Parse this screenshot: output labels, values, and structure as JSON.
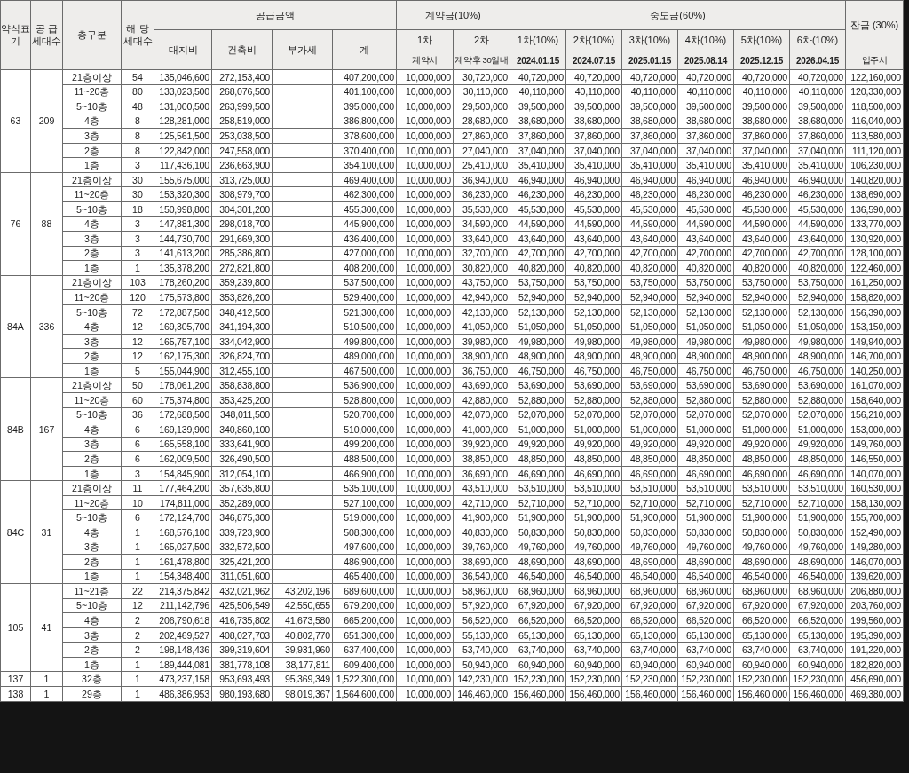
{
  "columns": {
    "type": "약식표기",
    "supply_units": "공 급 세대수",
    "floor": "층구분",
    "units": "해 당 세대수",
    "supply_price": {
      "label": "공급금액",
      "parts": [
        "대지비",
        "건축비",
        "부가세",
        "계"
      ]
    },
    "deposit": {
      "label": "계약금(10%)",
      "parts": [
        {
          "label": "1차",
          "due": "계약시"
        },
        {
          "label": "2차",
          "due": "계약후 30일내"
        }
      ]
    },
    "middle": {
      "label": "중도금(60%)",
      "parts": [
        {
          "label": "1차(10%)",
          "due": "2024.01.15"
        },
        {
          "label": "2차(10%)",
          "due": "2024.07.15"
        },
        {
          "label": "3차(10%)",
          "due": "2025.01.15"
        },
        {
          "label": "4차(10%)",
          "due": "2025.08.14"
        },
        {
          "label": "5차(10%)",
          "due": "2025.12.15"
        },
        {
          "label": "6차(10%)",
          "due": "2026.04.15"
        }
      ]
    },
    "balance": {
      "label": "잔금 (30%)",
      "due": "입주시"
    }
  },
  "groups": [
    {
      "type": "63",
      "supply_units": "209",
      "rows": [
        {
          "floor": "21층이상",
          "units": "54",
          "land": "135,046,600",
          "building": "272,153,400",
          "total": "407,200,000",
          "deposit_1": "10,000,000",
          "deposit_2": "30,720,000",
          "middle": [
            "40,720,000",
            "40,720,000",
            "40,720,000",
            "40,720,000",
            "40,720,000",
            "40,720,000"
          ],
          "balance": "122,160,000"
        },
        {
          "floor": "11~20층",
          "units": "80",
          "land": "133,023,500",
          "building": "268,076,500",
          "total": "401,100,000",
          "deposit_1": "10,000,000",
          "deposit_2": "30,110,000",
          "middle": [
            "40,110,000",
            "40,110,000",
            "40,110,000",
            "40,110,000",
            "40,110,000",
            "40,110,000"
          ],
          "balance": "120,330,000"
        },
        {
          "floor": "5~10층",
          "units": "48",
          "land": "131,000,500",
          "building": "263,999,500",
          "total": "395,000,000",
          "deposit_1": "10,000,000",
          "deposit_2": "29,500,000",
          "middle": [
            "39,500,000",
            "39,500,000",
            "39,500,000",
            "39,500,000",
            "39,500,000",
            "39,500,000"
          ],
          "balance": "118,500,000"
        },
        {
          "floor": "4층",
          "units": "8",
          "land": "128,281,000",
          "building": "258,519,000",
          "total": "386,800,000",
          "deposit_1": "10,000,000",
          "deposit_2": "28,680,000",
          "middle": [
            "38,680,000",
            "38,680,000",
            "38,680,000",
            "38,680,000",
            "38,680,000",
            "38,680,000"
          ],
          "balance": "116,040,000"
        },
        {
          "floor": "3층",
          "units": "8",
          "land": "125,561,500",
          "building": "253,038,500",
          "total": "378,600,000",
          "deposit_1": "10,000,000",
          "deposit_2": "27,860,000",
          "middle": [
            "37,860,000",
            "37,860,000",
            "37,860,000",
            "37,860,000",
            "37,860,000",
            "37,860,000"
          ],
          "balance": "113,580,000"
        },
        {
          "floor": "2층",
          "units": "8",
          "land": "122,842,000",
          "building": "247,558,000",
          "total": "370,400,000",
          "deposit_1": "10,000,000",
          "deposit_2": "27,040,000",
          "middle": [
            "37,040,000",
            "37,040,000",
            "37,040,000",
            "37,040,000",
            "37,040,000",
            "37,040,000"
          ],
          "balance": "111,120,000"
        },
        {
          "floor": "1층",
          "units": "3",
          "land": "117,436,100",
          "building": "236,663,900",
          "total": "354,100,000",
          "deposit_1": "10,000,000",
          "deposit_2": "25,410,000",
          "middle": [
            "35,410,000",
            "35,410,000",
            "35,410,000",
            "35,410,000",
            "35,410,000",
            "35,410,000"
          ],
          "balance": "106,230,000"
        }
      ]
    },
    {
      "type": "76",
      "supply_units": "88",
      "rows": [
        {
          "floor": "21층이상",
          "units": "30",
          "land": "155,675,000",
          "building": "313,725,000",
          "total": "469,400,000",
          "deposit_1": "10,000,000",
          "deposit_2": "36,940,000",
          "middle": [
            "46,940,000",
            "46,940,000",
            "46,940,000",
            "46,940,000",
            "46,940,000",
            "46,940,000"
          ],
          "balance": "140,820,000"
        },
        {
          "floor": "11~20층",
          "units": "30",
          "land": "153,320,300",
          "building": "308,979,700",
          "total": "462,300,000",
          "deposit_1": "10,000,000",
          "deposit_2": "36,230,000",
          "middle": [
            "46,230,000",
            "46,230,000",
            "46,230,000",
            "46,230,000",
            "46,230,000",
            "46,230,000"
          ],
          "balance": "138,690,000"
        },
        {
          "floor": "5~10층",
          "units": "18",
          "land": "150,998,800",
          "building": "304,301,200",
          "total": "455,300,000",
          "deposit_1": "10,000,000",
          "deposit_2": "35,530,000",
          "middle": [
            "45,530,000",
            "45,530,000",
            "45,530,000",
            "45,530,000",
            "45,530,000",
            "45,530,000"
          ],
          "balance": "136,590,000"
        },
        {
          "floor": "4층",
          "units": "3",
          "land": "147,881,300",
          "building": "298,018,700",
          "total": "445,900,000",
          "deposit_1": "10,000,000",
          "deposit_2": "34,590,000",
          "middle": [
            "44,590,000",
            "44,590,000",
            "44,590,000",
            "44,590,000",
            "44,590,000",
            "44,590,000"
          ],
          "balance": "133,770,000"
        },
        {
          "floor": "3층",
          "units": "3",
          "land": "144,730,700",
          "building": "291,669,300",
          "total": "436,400,000",
          "deposit_1": "10,000,000",
          "deposit_2": "33,640,000",
          "middle": [
            "43,640,000",
            "43,640,000",
            "43,640,000",
            "43,640,000",
            "43,640,000",
            "43,640,000"
          ],
          "balance": "130,920,000"
        },
        {
          "floor": "2층",
          "units": "3",
          "land": "141,613,200",
          "building": "285,386,800",
          "total": "427,000,000",
          "deposit_1": "10,000,000",
          "deposit_2": "32,700,000",
          "middle": [
            "42,700,000",
            "42,700,000",
            "42,700,000",
            "42,700,000",
            "42,700,000",
            "42,700,000"
          ],
          "balance": "128,100,000"
        },
        {
          "floor": "1층",
          "units": "1",
          "land": "135,378,200",
          "building": "272,821,800",
          "total": "408,200,000",
          "deposit_1": "10,000,000",
          "deposit_2": "30,820,000",
          "middle": [
            "40,820,000",
            "40,820,000",
            "40,820,000",
            "40,820,000",
            "40,820,000",
            "40,820,000"
          ],
          "balance": "122,460,000"
        }
      ]
    },
    {
      "type": "84A",
      "supply_units": "336",
      "rows": [
        {
          "floor": "21층이상",
          "units": "103",
          "land": "178,260,200",
          "building": "359,239,800",
          "total": "537,500,000",
          "deposit_1": "10,000,000",
          "deposit_2": "43,750,000",
          "middle": [
            "53,750,000",
            "53,750,000",
            "53,750,000",
            "53,750,000",
            "53,750,000",
            "53,750,000"
          ],
          "balance": "161,250,000"
        },
        {
          "floor": "11~20층",
          "units": "120",
          "land": "175,573,800",
          "building": "353,826,200",
          "total": "529,400,000",
          "deposit_1": "10,000,000",
          "deposit_2": "42,940,000",
          "middle": [
            "52,940,000",
            "52,940,000",
            "52,940,000",
            "52,940,000",
            "52,940,000",
            "52,940,000"
          ],
          "balance": "158,820,000"
        },
        {
          "floor": "5~10층",
          "units": "72",
          "land": "172,887,500",
          "building": "348,412,500",
          "total": "521,300,000",
          "deposit_1": "10,000,000",
          "deposit_2": "42,130,000",
          "middle": [
            "52,130,000",
            "52,130,000",
            "52,130,000",
            "52,130,000",
            "52,130,000",
            "52,130,000"
          ],
          "balance": "156,390,000"
        },
        {
          "floor": "4층",
          "units": "12",
          "land": "169,305,700",
          "building": "341,194,300",
          "total": "510,500,000",
          "deposit_1": "10,000,000",
          "deposit_2": "41,050,000",
          "middle": [
            "51,050,000",
            "51,050,000",
            "51,050,000",
            "51,050,000",
            "51,050,000",
            "51,050,000"
          ],
          "balance": "153,150,000"
        },
        {
          "floor": "3층",
          "units": "12",
          "land": "165,757,100",
          "building": "334,042,900",
          "total": "499,800,000",
          "deposit_1": "10,000,000",
          "deposit_2": "39,980,000",
          "middle": [
            "49,980,000",
            "49,980,000",
            "49,980,000",
            "49,980,000",
            "49,980,000",
            "49,980,000"
          ],
          "balance": "149,940,000"
        },
        {
          "floor": "2층",
          "units": "12",
          "land": "162,175,300",
          "building": "326,824,700",
          "total": "489,000,000",
          "deposit_1": "10,000,000",
          "deposit_2": "38,900,000",
          "middle": [
            "48,900,000",
            "48,900,000",
            "48,900,000",
            "48,900,000",
            "48,900,000",
            "48,900,000"
          ],
          "balance": "146,700,000"
        },
        {
          "floor": "1층",
          "units": "5",
          "land": "155,044,900",
          "building": "312,455,100",
          "total": "467,500,000",
          "deposit_1": "10,000,000",
          "deposit_2": "36,750,000",
          "middle": [
            "46,750,000",
            "46,750,000",
            "46,750,000",
            "46,750,000",
            "46,750,000",
            "46,750,000"
          ],
          "balance": "140,250,000"
        }
      ]
    },
    {
      "type": "84B",
      "supply_units": "167",
      "rows": [
        {
          "floor": "21층이상",
          "units": "50",
          "land": "178,061,200",
          "building": "358,838,800",
          "total": "536,900,000",
          "deposit_1": "10,000,000",
          "deposit_2": "43,690,000",
          "middle": [
            "53,690,000",
            "53,690,000",
            "53,690,000",
            "53,690,000",
            "53,690,000",
            "53,690,000"
          ],
          "balance": "161,070,000"
        },
        {
          "floor": "11~20층",
          "units": "60",
          "land": "175,374,800",
          "building": "353,425,200",
          "total": "528,800,000",
          "deposit_1": "10,000,000",
          "deposit_2": "42,880,000",
          "middle": [
            "52,880,000",
            "52,880,000",
            "52,880,000",
            "52,880,000",
            "52,880,000",
            "52,880,000"
          ],
          "balance": "158,640,000"
        },
        {
          "floor": "5~10층",
          "units": "36",
          "land": "172,688,500",
          "building": "348,011,500",
          "total": "520,700,000",
          "deposit_1": "10,000,000",
          "deposit_2": "42,070,000",
          "middle": [
            "52,070,000",
            "52,070,000",
            "52,070,000",
            "52,070,000",
            "52,070,000",
            "52,070,000"
          ],
          "balance": "156,210,000"
        },
        {
          "floor": "4층",
          "units": "6",
          "land": "169,139,900",
          "building": "340,860,100",
          "total": "510,000,000",
          "deposit_1": "10,000,000",
          "deposit_2": "41,000,000",
          "middle": [
            "51,000,000",
            "51,000,000",
            "51,000,000",
            "51,000,000",
            "51,000,000",
            "51,000,000"
          ],
          "balance": "153,000,000"
        },
        {
          "floor": "3층",
          "units": "6",
          "land": "165,558,100",
          "building": "333,641,900",
          "total": "499,200,000",
          "deposit_1": "10,000,000",
          "deposit_2": "39,920,000",
          "middle": [
            "49,920,000",
            "49,920,000",
            "49,920,000",
            "49,920,000",
            "49,920,000",
            "49,920,000"
          ],
          "balance": "149,760,000"
        },
        {
          "floor": "2층",
          "units": "6",
          "land": "162,009,500",
          "building": "326,490,500",
          "total": "488,500,000",
          "deposit_1": "10,000,000",
          "deposit_2": "38,850,000",
          "middle": [
            "48,850,000",
            "48,850,000",
            "48,850,000",
            "48,850,000",
            "48,850,000",
            "48,850,000"
          ],
          "balance": "146,550,000"
        },
        {
          "floor": "1층",
          "units": "3",
          "land": "154,845,900",
          "building": "312,054,100",
          "total": "466,900,000",
          "deposit_1": "10,000,000",
          "deposit_2": "36,690,000",
          "middle": [
            "46,690,000",
            "46,690,000",
            "46,690,000",
            "46,690,000",
            "46,690,000",
            "46,690,000"
          ],
          "balance": "140,070,000"
        }
      ]
    },
    {
      "type": "84C",
      "supply_units": "31",
      "rows": [
        {
          "floor": "21층이상",
          "units": "11",
          "land": "177,464,200",
          "building": "357,635,800",
          "total": "535,100,000",
          "deposit_1": "10,000,000",
          "deposit_2": "43,510,000",
          "middle": [
            "53,510,000",
            "53,510,000",
            "53,510,000",
            "53,510,000",
            "53,510,000",
            "53,510,000"
          ],
          "balance": "160,530,000"
        },
        {
          "floor": "11~20층",
          "units": "10",
          "land": "174,811,000",
          "building": "352,289,000",
          "total": "527,100,000",
          "deposit_1": "10,000,000",
          "deposit_2": "42,710,000",
          "middle": [
            "52,710,000",
            "52,710,000",
            "52,710,000",
            "52,710,000",
            "52,710,000",
            "52,710,000"
          ],
          "balance": "158,130,000"
        },
        {
          "floor": "5~10층",
          "units": "6",
          "land": "172,124,700",
          "building": "346,875,300",
          "total": "519,000,000",
          "deposit_1": "10,000,000",
          "deposit_2": "41,900,000",
          "middle": [
            "51,900,000",
            "51,900,000",
            "51,900,000",
            "51,900,000",
            "51,900,000",
            "51,900,000"
          ],
          "balance": "155,700,000"
        },
        {
          "floor": "4층",
          "units": "1",
          "land": "168,576,100",
          "building": "339,723,900",
          "total": "508,300,000",
          "deposit_1": "10,000,000",
          "deposit_2": "40,830,000",
          "middle": [
            "50,830,000",
            "50,830,000",
            "50,830,000",
            "50,830,000",
            "50,830,000",
            "50,830,000"
          ],
          "balance": "152,490,000"
        },
        {
          "floor": "3층",
          "units": "1",
          "land": "165,027,500",
          "building": "332,572,500",
          "total": "497,600,000",
          "deposit_1": "10,000,000",
          "deposit_2": "39,760,000",
          "middle": [
            "49,760,000",
            "49,760,000",
            "49,760,000",
            "49,760,000",
            "49,760,000",
            "49,760,000"
          ],
          "balance": "149,280,000"
        },
        {
          "floor": "2층",
          "units": "1",
          "land": "161,478,800",
          "building": "325,421,200",
          "total": "486,900,000",
          "deposit_1": "10,000,000",
          "deposit_2": "38,690,000",
          "middle": [
            "48,690,000",
            "48,690,000",
            "48,690,000",
            "48,690,000",
            "48,690,000",
            "48,690,000"
          ],
          "balance": "146,070,000"
        },
        {
          "floor": "1층",
          "units": "1",
          "land": "154,348,400",
          "building": "311,051,600",
          "total": "465,400,000",
          "deposit_1": "10,000,000",
          "deposit_2": "36,540,000",
          "middle": [
            "46,540,000",
            "46,540,000",
            "46,540,000",
            "46,540,000",
            "46,540,000",
            "46,540,000"
          ],
          "balance": "139,620,000"
        }
      ]
    },
    {
      "type": "105",
      "supply_units": "41",
      "rows": [
        {
          "floor": "11~21층",
          "units": "22",
          "land": "214,375,842",
          "building": "432,021,962",
          "vat": "43,202,196",
          "total": "689,600,000",
          "deposit_1": "10,000,000",
          "deposit_2": "58,960,000",
          "middle": [
            "68,960,000",
            "68,960,000",
            "68,960,000",
            "68,960,000",
            "68,960,000",
            "68,960,000"
          ],
          "balance": "206,880,000"
        },
        {
          "floor": "5~10층",
          "units": "12",
          "land": "211,142,796",
          "building": "425,506,549",
          "vat": "42,550,655",
          "total": "679,200,000",
          "deposit_1": "10,000,000",
          "deposit_2": "57,920,000",
          "middle": [
            "67,920,000",
            "67,920,000",
            "67,920,000",
            "67,920,000",
            "67,920,000",
            "67,920,000"
          ],
          "balance": "203,760,000"
        },
        {
          "floor": "4층",
          "units": "2",
          "land": "206,790,618",
          "building": "416,735,802",
          "vat": "41,673,580",
          "total": "665,200,000",
          "deposit_1": "10,000,000",
          "deposit_2": "56,520,000",
          "middle": [
            "66,520,000",
            "66,520,000",
            "66,520,000",
            "66,520,000",
            "66,520,000",
            "66,520,000"
          ],
          "balance": "199,560,000"
        },
        {
          "floor": "3층",
          "units": "2",
          "land": "202,469,527",
          "building": "408,027,703",
          "vat": "40,802,770",
          "total": "651,300,000",
          "deposit_1": "10,000,000",
          "deposit_2": "55,130,000",
          "middle": [
            "65,130,000",
            "65,130,000",
            "65,130,000",
            "65,130,000",
            "65,130,000",
            "65,130,000"
          ],
          "balance": "195,390,000"
        },
        {
          "floor": "2층",
          "units": "2",
          "land": "198,148,436",
          "building": "399,319,604",
          "vat": "39,931,960",
          "total": "637,400,000",
          "deposit_1": "10,000,000",
          "deposit_2": "53,740,000",
          "middle": [
            "63,740,000",
            "63,740,000",
            "63,740,000",
            "63,740,000",
            "63,740,000",
            "63,740,000"
          ],
          "balance": "191,220,000"
        },
        {
          "floor": "1층",
          "units": "1",
          "land": "189,444,081",
          "building": "381,778,108",
          "vat": "38,177,811",
          "total": "609,400,000",
          "deposit_1": "10,000,000",
          "deposit_2": "50,940,000",
          "middle": [
            "60,940,000",
            "60,940,000",
            "60,940,000",
            "60,940,000",
            "60,940,000",
            "60,940,000"
          ],
          "balance": "182,820,000"
        }
      ]
    },
    {
      "type": "137",
      "supply_units": "1",
      "rows": [
        {
          "floor": "32층",
          "units": "1",
          "land": "473,237,158",
          "building": "953,693,493",
          "vat": "95,369,349",
          "total": "1,522,300,000",
          "deposit_1": "10,000,000",
          "deposit_2": "142,230,000",
          "middle": [
            "152,230,000",
            "152,230,000",
            "152,230,000",
            "152,230,000",
            "152,230,000",
            "152,230,000"
          ],
          "balance": "456,690,000"
        }
      ]
    },
    {
      "type": "138",
      "supply_units": "1",
      "rows": [
        {
          "floor": "29층",
          "units": "1",
          "land": "486,386,953",
          "building": "980,193,680",
          "vat": "98,019,367",
          "total": "1,564,600,000",
          "deposit_1": "10,000,000",
          "deposit_2": "146,460,000",
          "middle": [
            "156,460,000",
            "156,460,000",
            "156,460,000",
            "156,460,000",
            "156,460,000",
            "156,460,000"
          ],
          "balance": "469,380,000"
        }
      ]
    }
  ]
}
